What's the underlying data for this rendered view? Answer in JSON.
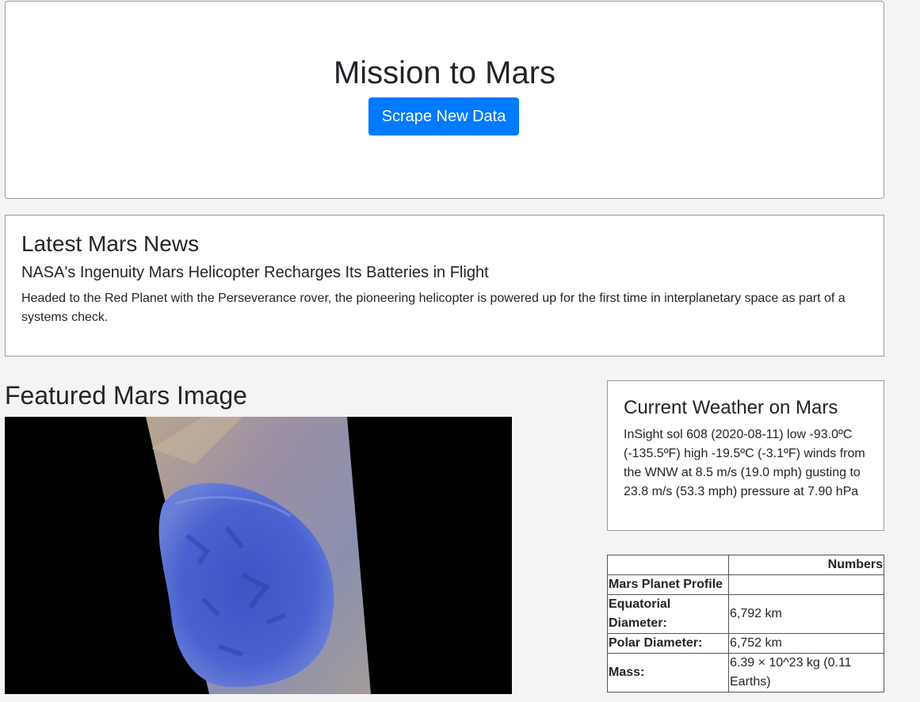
{
  "header": {
    "title": "Mission to Mars",
    "scrape_button": "Scrape New Data"
  },
  "news": {
    "heading": "Latest Mars News",
    "title": "NASA's Ingenuity Mars Helicopter Recharges Its Batteries in Flight",
    "paragraph": "Headed to the Red Planet with the Perseverance rover, the pioneering helicopter is powered up for the first time in interplanetary space as part of a systems check."
  },
  "featured": {
    "heading": "Featured Mars Image"
  },
  "weather": {
    "heading": "Current Weather on Mars",
    "text": "InSight sol 608 (2020-08-11) low -93.0ºC (-135.5ºF) high -19.5ºC (-3.1ºF) winds from the WNW at 8.5 m/s (19.0 mph) gusting to 23.8 m/s (53.3 mph) pressure at 7.90 hPa"
  },
  "facts": {
    "header": [
      "",
      "Numbers"
    ],
    "rows": [
      {
        "label": "Mars Planet Profile",
        "value": ""
      },
      {
        "label": "Equatorial Diameter:",
        "value": "6,792 km"
      },
      {
        "label": "Polar Diameter:",
        "value": "6,752 km"
      },
      {
        "label": "Mass:",
        "value": "6.39 × 10^23 kg (0.11 Earths)"
      }
    ]
  },
  "colors": {
    "accent": "#007bff",
    "background": "#f4f4f4"
  }
}
